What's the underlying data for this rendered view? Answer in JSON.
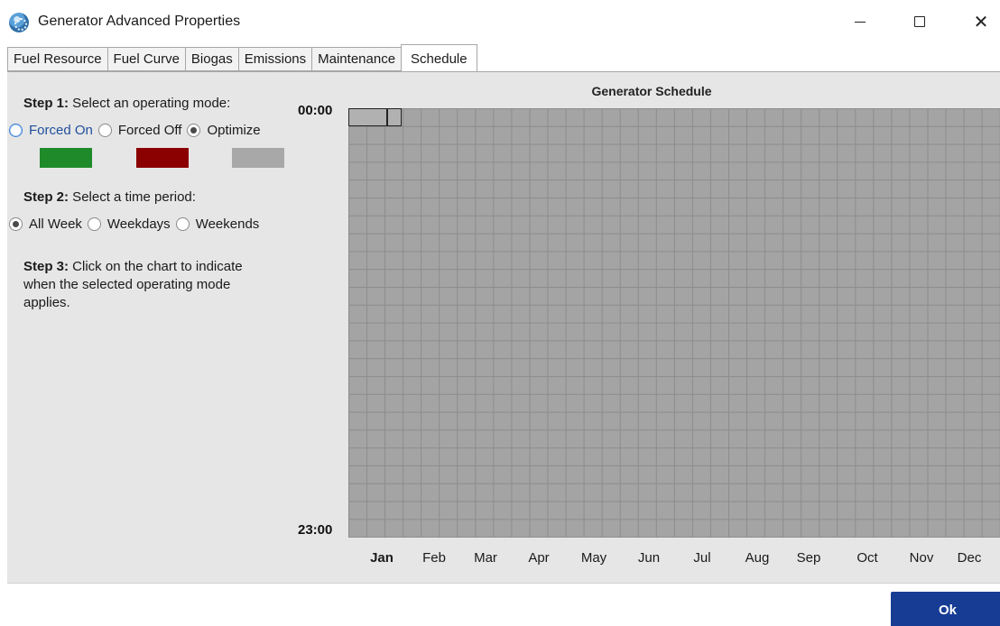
{
  "window": {
    "title": "Generator Advanced Properties",
    "icon": "generator-app-icon"
  },
  "tabs": [
    {
      "label": "Fuel Resource",
      "active": false
    },
    {
      "label": "Fuel Curve",
      "active": false
    },
    {
      "label": "Biogas",
      "active": false
    },
    {
      "label": "Emissions",
      "active": false
    },
    {
      "label": "Maintenance",
      "active": false
    },
    {
      "label": "Schedule",
      "active": true
    }
  ],
  "step1": {
    "bold": "Step 1:",
    "text": " Select an operating mode:",
    "modes": [
      {
        "label": "Forced On",
        "selected": false,
        "color": "#1f8a2a"
      },
      {
        "label": "Forced Off",
        "selected": false,
        "color": "#8b0000"
      },
      {
        "label": "Optimize",
        "selected": true,
        "color": "#a8a8a8"
      }
    ]
  },
  "step2": {
    "bold": "Step 2:",
    "text": " Select a time period:",
    "periods": [
      {
        "label": "All Week",
        "selected": true
      },
      {
        "label": "Weekdays",
        "selected": false
      },
      {
        "label": "Weekends",
        "selected": false
      }
    ]
  },
  "step3": {
    "bold": "Step 3:",
    "line1": " Click on the chart to indicate",
    "line2": "when the selected operating mode",
    "line3": "applies."
  },
  "chart": {
    "title": "Generator Schedule",
    "y_top": "00:00",
    "y_bottom": "23:00",
    "months": [
      "Jan",
      "Feb",
      "Mar",
      "Apr",
      "May",
      "Jun",
      "Jul",
      "Aug",
      "Sep",
      "Oct",
      "Nov",
      "Dec"
    ],
    "selected_month": "Jan"
  },
  "ok_label": "Ok"
}
